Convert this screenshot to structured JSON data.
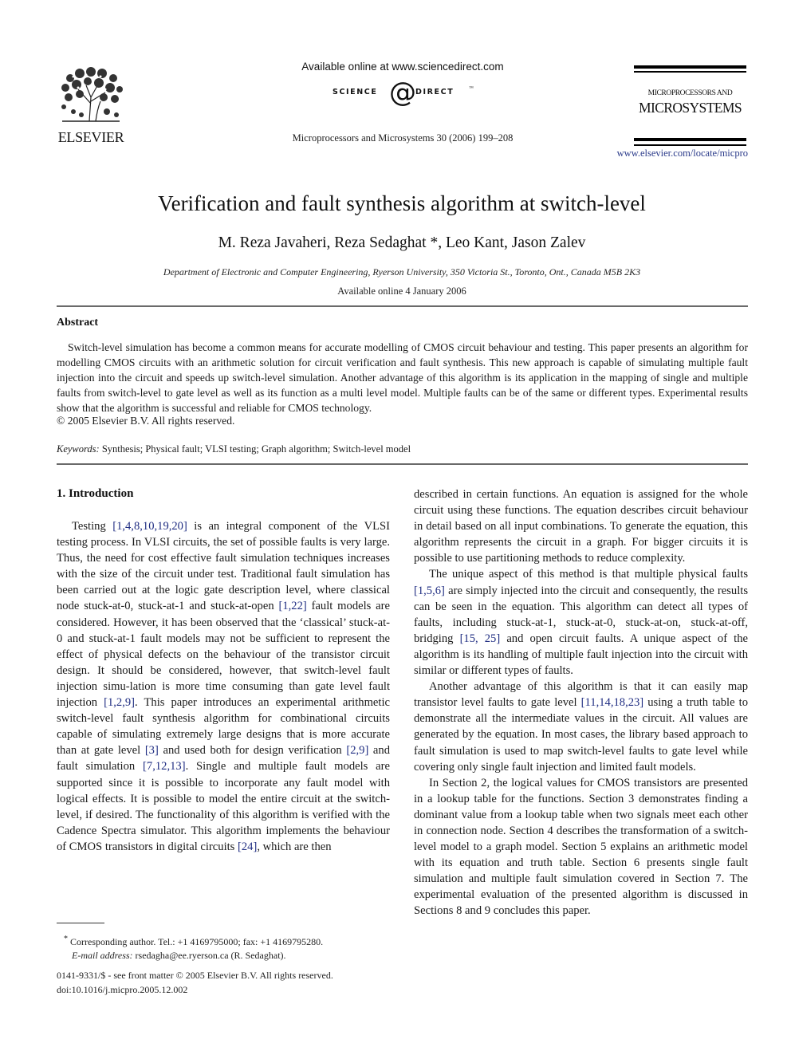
{
  "header": {
    "publisher_logo_label": "ELSEVIER",
    "publisher_logo_icon": "elsevier-tree-icon",
    "sciencedirect_available": "Available online at www.sciencedirect.com",
    "sciencedirect_left": "SCIENCE",
    "sciencedirect_at": "@",
    "sciencedirect_right": "DIRECT",
    "sciencedirect_tm": "™",
    "journal_citation": "Microprocessors and Microsystems 30 (2006) 199–208",
    "journal_name_small": "MICROPROCESSORS AND",
    "journal_name_large": "MICROSYSTEMS",
    "journal_url": "www.elsevier.com/locate/micpro"
  },
  "article": {
    "title": "Verification and fault synthesis algorithm at switch-level",
    "authors": "M. Reza Javaheri, Reza Sedaghat *, Leo Kant, Jason Zalev",
    "affiliation": "Department of Electronic and Computer Engineering, Ryerson University, 350 Victoria St., Toronto, Ont., Canada M5B 2K3",
    "available_online": "Available online 4 January 2006"
  },
  "abstract": {
    "heading": "Abstract",
    "body": "Switch-level simulation has become a common means for accurate modelling of CMOS circuit behaviour and testing. This paper presents an algorithm for modelling CMOS circuits with an arithmetic solution for circuit verification and fault synthesis. This new approach is capable of simulating multiple fault injection into the circuit and speeds up switch-level simulation. Another advantage of this algorithm is its application in the mapping of single and multiple faults from switch-level to gate level as well as its function as a multi level model. Multiple faults can be of the same or different types. Experimental results show that the algorithm is successful and reliable for CMOS technology.",
    "copyright": "© 2005 Elsevier B.V. All rights reserved.",
    "keywords_label": "Keywords:",
    "keywords": "Synthesis; Physical fault; VLSI testing; Graph algorithm; Switch-level model"
  },
  "introduction": {
    "heading": "1. Introduction",
    "p1": {
      "t0": "Testing ",
      "c0": "[1,4,8,10,19,20]",
      "t1": " is an integral component of the VLSI testing process. In VLSI circuits, the set of possible faults is very large. Thus, the need for cost effective fault simulation techniques increases with the size of the circuit under test. Traditional fault simulation has been carried out at the logic gate description level, where classical node stuck-at-0, stuck-at-1 and stuck-at-open ",
      "c1": "[1,22]",
      "t2": " fault models are considered. However, it has been observed that the ‘classical’ stuck-at-0 and stuck-at-1 fault models may not be sufficient to represent the effect of physical defects on the behaviour of the transistor circuit design. It should be considered, however, that switch-level fault injection simu-lation is more time consuming than gate level fault injection ",
      "c2": "[1,2,9]",
      "t3": ". This paper introduces an experimental arithmetic switch-level fault synthesis algorithm for combinational circuits capable of simulating extremely large designs that is more accurate than at gate level ",
      "c3": "[3]",
      "t4": " and used both for design verification ",
      "c4": "[2,9]",
      "t5": " and fault simulation ",
      "c5": "[7,12,13]",
      "t6": ". Single and multiple fault models are supported since it is possible to incorporate any fault model with logical effects. It is possible to model the entire circuit at the switch-level, if desired. The functionality of this algorithm is verified with the Cadence Spectra simulator. This algorithm implements the behaviour of CMOS transistors in digital circuits ",
      "c6": "[24]",
      "t7": ", which are then"
    },
    "p1_cont": "described in certain functions. An equation is assigned for the whole circuit using these functions. The equation describes circuit behaviour in detail based on all input combinations. To generate the equation, this algorithm represents the circuit in a graph. For bigger circuits it is possible to use partitioning methods to reduce complexity.",
    "p2": {
      "t0": "The unique aspect of this method is that multiple physical faults ",
      "c0": "[1,5,6]",
      "t1": " are simply injected into the circuit and consequently, the results can be seen in the equation. This algorithm can detect all types of faults, including stuck-at-1, stuck-at-0, stuck-at-on, stuck-at-off, bridging ",
      "c1": "[15, 25]",
      "t2": " and open circuit faults. A unique aspect of the algorithm is its handling of multiple fault injection into the circuit with similar or different types of faults."
    },
    "p3": {
      "t0": "Another advantage of this algorithm is that it can easily map transistor level faults to gate level ",
      "c0": "[11,14,18,23]",
      "t1": " using a truth table to demonstrate all the intermediate values in the circuit. All values are generated by the equation. In most cases, the library based approach to fault simulation is used to map switch-level faults to gate level while covering only single fault injection and limited fault models."
    },
    "p4": "In Section 2, the logical values for CMOS transistors are presented in a lookup table for the functions. Section 3 demonstrates finding a dominant value from a lookup table when two signals meet each other in connection node. Section 4 describes the transformation of a switch-level model to a graph model. Section 5 explains an arithmetic model with its equation and truth table. Section 6 presents single fault simulation and multiple fault simulation covered in Section 7. The experimental evaluation of the presented algorithm is discussed in Sections 8 and 9 concludes this paper."
  },
  "footnote": {
    "marker": "*",
    "contact": "Corresponding author. Tel.: +1 4169795000; fax: +1 4169795280.",
    "email_label": "E-mail address:",
    "email": "rsedagha@ee.ryerson.ca (R. Sedaghat)."
  },
  "front_matter": {
    "issn": "0141-9331/$ - see front matter © 2005 Elsevier B.V. All rights reserved.",
    "doi": "doi:10.1016/j.micpro.2005.12.002"
  },
  "colors": {
    "citation_link": "#1f2d82",
    "url_link": "#2a3a8a",
    "rule": "#6a6a6a"
  }
}
